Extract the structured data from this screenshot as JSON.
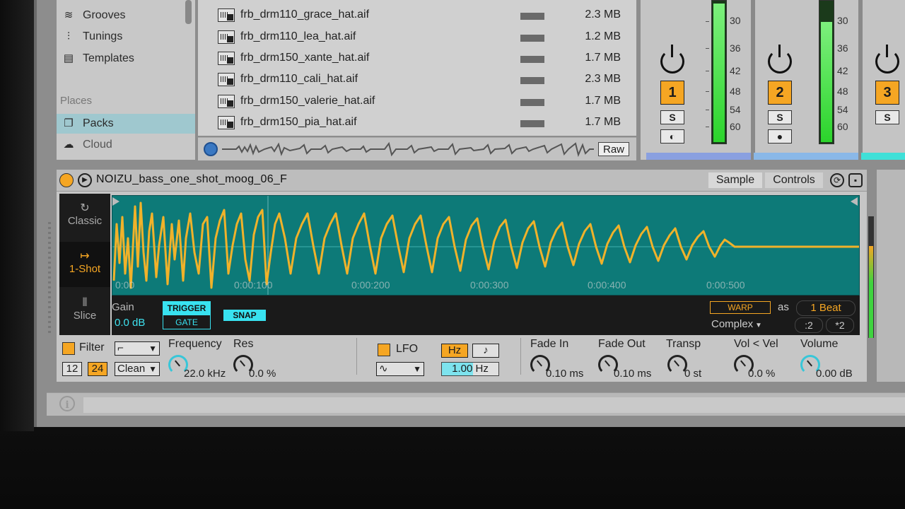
{
  "sidebar": {
    "items": [
      {
        "label": "Grooves",
        "icon": "grooves-icon"
      },
      {
        "label": "Tunings",
        "icon": "tunings-icon"
      },
      {
        "label": "Templates",
        "icon": "templates-icon"
      },
      {
        "label": "Packs",
        "icon": "packs-icon"
      },
      {
        "label": "Cloud",
        "icon": "cloud-icon"
      }
    ],
    "places_heading": "Places"
  },
  "files": [
    {
      "name": "frb_drm110_grace_hat.aif",
      "size": "2.3 MB"
    },
    {
      "name": "frb_drm110_lea_hat.aif",
      "size": "1.2 MB"
    },
    {
      "name": "frb_drm150_xante_hat.aif",
      "size": "1.7 MB"
    },
    {
      "name": "frb_drm110_cali_hat.aif",
      "size": "2.3 MB"
    },
    {
      "name": "frb_drm150_valerie_hat.aif",
      "size": "1.7 MB"
    },
    {
      "name": "frb_drm150_pia_hat.aif",
      "size": "1.7 MB"
    }
  ],
  "preview": {
    "raw_label": "Raw"
  },
  "mixer": {
    "tracks": [
      {
        "number": "1",
        "solo": "S"
      },
      {
        "number": "2",
        "solo": "S"
      },
      {
        "number": "3",
        "solo": "S"
      }
    ],
    "db_scale": [
      "30",
      "36",
      "42",
      "48",
      "54",
      "60"
    ]
  },
  "device": {
    "name": "NOIZU_bass_one_shot_moog_06_F",
    "tabs": {
      "sample": "Sample",
      "controls": "Controls"
    },
    "modes": {
      "classic": "Classic",
      "one_shot": "1-Shot",
      "slice": "Slice"
    },
    "timeline": [
      "0:00",
      "0:00:100",
      "0:00:200",
      "0:00:300",
      "0:00:400",
      "0:00:500"
    ],
    "gain_label": "Gain",
    "gain_value": "0.0 dB",
    "trigger": "TRIGGER",
    "gate": "GATE",
    "snap": "SNAP",
    "warp": "WARP",
    "as": "as",
    "beat": "1 Beat",
    "warp_mode": "Complex",
    "half": ":2",
    "double": "*2"
  },
  "controls": {
    "filter_label": "Filter",
    "slope_12": "12",
    "slope_24": "24",
    "filter_circuit": "Clean",
    "frequency_label": "Frequency",
    "frequency_value": "22.0 kHz",
    "res_label": "Res",
    "res_value": "0.0 %",
    "lfo_label": "LFO",
    "hz_label": "Hz",
    "note_label": "♪",
    "lfo_rate": "1.00 Hz",
    "lfo_rate_fraction": 0.55,
    "fade_in_label": "Fade In",
    "fade_in_value": "0.10 ms",
    "fade_out_label": "Fade Out",
    "fade_out_value": "0.10 ms",
    "transp_label": "Transp",
    "transp_value": "0 st",
    "volvel_label": "Vol < Vel",
    "volvel_value": "0.0 %",
    "volume_label": "Volume",
    "volume_value": "0.00 dB"
  },
  "colors": {
    "accent": "#f5a623",
    "waveform_bg": "#0d7a78",
    "waveform": "#f0b22a",
    "cyan": "#38e2f0"
  }
}
